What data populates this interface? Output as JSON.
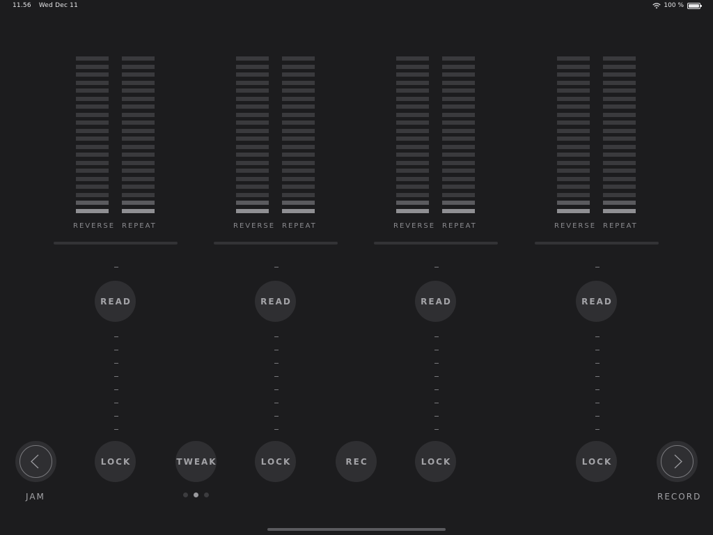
{
  "status": {
    "time": "11.56",
    "date": "Wed Dec 11",
    "battery": "100 %"
  },
  "tracks": [
    {
      "reverse": "REVERSE",
      "repeat": "REPEAT",
      "read": "READ",
      "lock": "LOCK",
      "lit_segments": 2
    },
    {
      "reverse": "REVERSE",
      "repeat": "REPEAT",
      "read": "READ",
      "lock": "LOCK",
      "lit_segments": 2
    },
    {
      "reverse": "REVERSE",
      "repeat": "REPEAT",
      "read": "READ",
      "lock": "LOCK",
      "lit_segments": 2
    },
    {
      "reverse": "REVERSE",
      "repeat": "REPEAT",
      "read": "READ",
      "lock": "LOCK",
      "lit_segments": 2
    }
  ],
  "middle": {
    "tweak": "TWEAK",
    "rec": "REC"
  },
  "nav": {
    "left_label": "JAM",
    "right_label": "RECORD"
  },
  "pager": {
    "pages": 3,
    "active": 1
  },
  "colors": {
    "background": "#1c1c1e",
    "pad": "#2f2f32",
    "segment_off": "#3a3a3d",
    "segment_on": "#8f8f93"
  }
}
